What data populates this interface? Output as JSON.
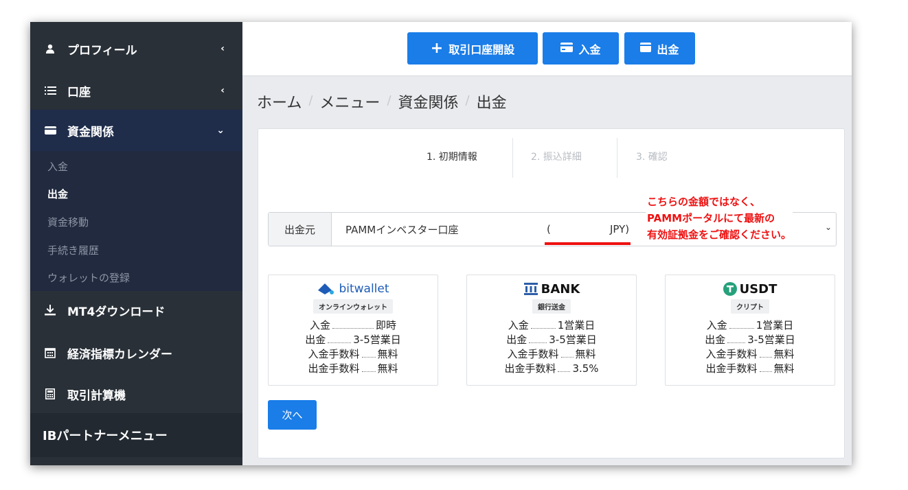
{
  "sidebar": {
    "items": [
      {
        "label": "プロフィール",
        "chevron": "‹"
      },
      {
        "label": "口座",
        "chevron": "‹"
      },
      {
        "label": "資金関係",
        "chevron": "⌄"
      },
      {
        "label": "MT4ダウンロード"
      },
      {
        "label": "経済指標カレンダー"
      },
      {
        "label": "取引計算機"
      }
    ],
    "submenu": [
      "入金",
      "出金",
      "資金移動",
      "手続き履歴",
      "ウォレットの登録"
    ],
    "ib_menu": "IBパートナーメニュー"
  },
  "topbar": {
    "open_account": "取引口座開設",
    "deposit": "入金",
    "withdraw": "出金"
  },
  "breadcrumb": [
    "ホーム",
    "メニュー",
    "資金関係",
    "出金"
  ],
  "steps": [
    "1. 初期情報",
    "2. 振込詳細",
    "3. 確認"
  ],
  "source": {
    "label": "出金元",
    "value": "PAMMインベスター口座",
    "paren_open": "(",
    "currency": "JPY)"
  },
  "annotation": [
    "こちらの金額ではなく、",
    "PAMMポータルにて最新の",
    "有効証拠金をご確認ください。"
  ],
  "methods": [
    {
      "brand_prefix": "",
      "brand": "bitwallet",
      "badge": "オンラインウォレット",
      "rows": [
        {
          "label": "入金",
          "value": "即時"
        },
        {
          "label": "出金",
          "value": "3-5営業日"
        },
        {
          "label": "入金手数料",
          "value": "無料"
        },
        {
          "label": "出金手数料",
          "value": "無料"
        }
      ]
    },
    {
      "brand": "BANK",
      "badge": "銀行送金",
      "rows": [
        {
          "label": "入金",
          "value": "1営業日"
        },
        {
          "label": "出金",
          "value": "3-5営業日"
        },
        {
          "label": "入金手数料",
          "value": "無料"
        },
        {
          "label": "出金手数料",
          "value": "3.5%"
        }
      ]
    },
    {
      "brand": "USDT",
      "badge": "クリプト",
      "rows": [
        {
          "label": "入金",
          "value": "1営業日"
        },
        {
          "label": "出金",
          "value": "3-5営業日"
        },
        {
          "label": "入金手数料",
          "value": "無料"
        },
        {
          "label": "出金手数料",
          "value": "無料"
        }
      ]
    }
  ],
  "next_button": "次へ",
  "colors": {
    "accent": "#1a7de8",
    "sidebar": "#293038",
    "annotation": "#ee1111",
    "usdt": "#26a17b",
    "bank": "#2c5ea8",
    "bitwallet": "#1e5cb8"
  }
}
